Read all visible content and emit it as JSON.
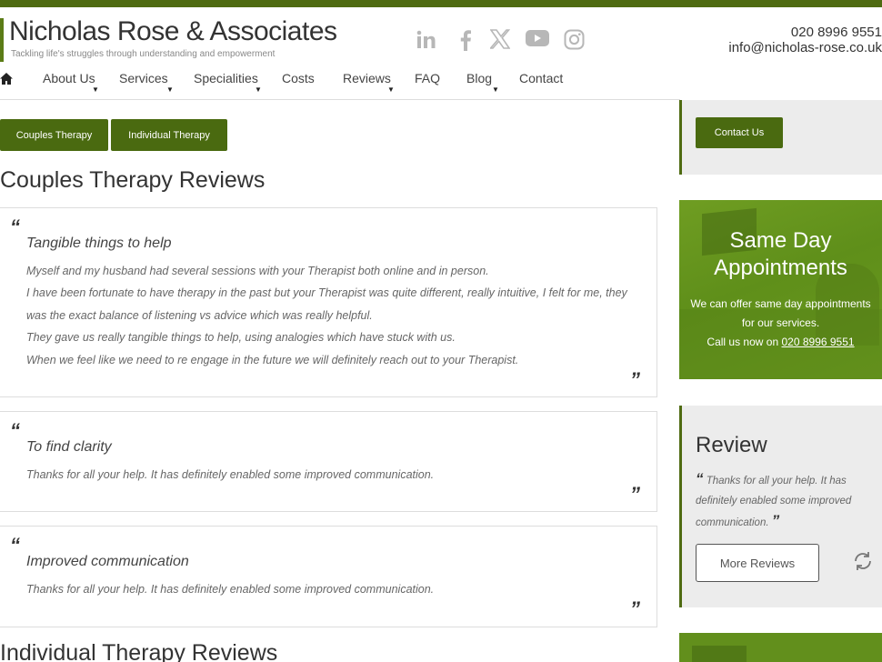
{
  "brand": {
    "name": "Nicholas Rose & Associates",
    "tagline": "Tackling life's struggles through understanding and empowerment",
    "accent_color": "#4f6b12"
  },
  "header": {
    "phone": "020 8996 9551",
    "email": "info@nicholas-rose.co.uk",
    "social": [
      "linkedin-icon",
      "facebook-icon",
      "x-icon",
      "youtube-icon",
      "instagram-icon"
    ]
  },
  "nav": {
    "items": [
      {
        "label": "About Us",
        "dropdown": true
      },
      {
        "label": "Services",
        "dropdown": true
      },
      {
        "label": "Specialities",
        "dropdown": true
      },
      {
        "label": "Costs",
        "dropdown": false
      },
      {
        "label": "Reviews",
        "dropdown": true
      },
      {
        "label": "FAQ",
        "dropdown": false
      },
      {
        "label": "Blog",
        "dropdown": true
      },
      {
        "label": "Contact",
        "dropdown": false
      }
    ]
  },
  "tabs": [
    {
      "label": "Couples Therapy"
    },
    {
      "label": "Individual Therapy"
    }
  ],
  "main": {
    "couples_title": "Couples Therapy Reviews",
    "individual_title": "Individual Therapy Reviews",
    "reviews": [
      {
        "title": "Tangible things to help",
        "paragraphs": [
          "Myself and my husband had several sessions with your Therapist both online and in person.",
          "I have been fortunate to have therapy in the past but your Therapist was quite different, really intuitive, I felt for me, they was the exact balance of listening vs advice which was really helpful.",
          "They gave us really tangible things to help, using analogies which have stuck with us.",
          "When we feel like we need to re engage in the future we will definitely reach out to your Therapist."
        ]
      },
      {
        "title": "To find clarity",
        "paragraphs": [
          "Thanks for all your help. It has definitely enabled some improved communication."
        ]
      },
      {
        "title": "Improved communication",
        "paragraphs": [
          "Thanks for all your help. It has definitely enabled some improved communication."
        ]
      }
    ]
  },
  "sidebar": {
    "contact_label": "Contact Us",
    "promo": {
      "title": "Same Day Appointments",
      "text": "We can offer same day appointments for our services.",
      "call_prefix": "Call us now on",
      "call_number": "020 8996 9551"
    },
    "review": {
      "title": "Review",
      "quote": "Thanks for all your help. It has definitely enabled some improved communication.",
      "more_label": "More Reviews"
    }
  }
}
